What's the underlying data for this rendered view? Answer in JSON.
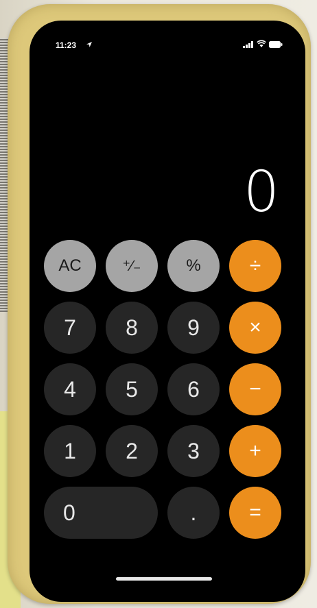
{
  "status_bar": {
    "time": "11:23",
    "location_icon": "location-arrow-icon",
    "signal_icon": "cellular-signal-icon",
    "wifi_icon": "wifi-icon",
    "battery_icon": "battery-icon"
  },
  "display": {
    "value": "0"
  },
  "keys": {
    "ac": "AC",
    "plus_minus": "⁺∕₋",
    "percent": "%",
    "divide": "÷",
    "seven": "7",
    "eight": "8",
    "nine": "9",
    "multiply": "×",
    "four": "4",
    "five": "5",
    "six": "6",
    "minus": "−",
    "one": "1",
    "two": "2",
    "three": "3",
    "plus": "+",
    "zero": "0",
    "decimal": ".",
    "equals": "="
  },
  "colors": {
    "function_key": "#a5a5a5",
    "number_key": "#262626",
    "operator_key": "#ec8e1c",
    "case": "#ddc87a"
  }
}
